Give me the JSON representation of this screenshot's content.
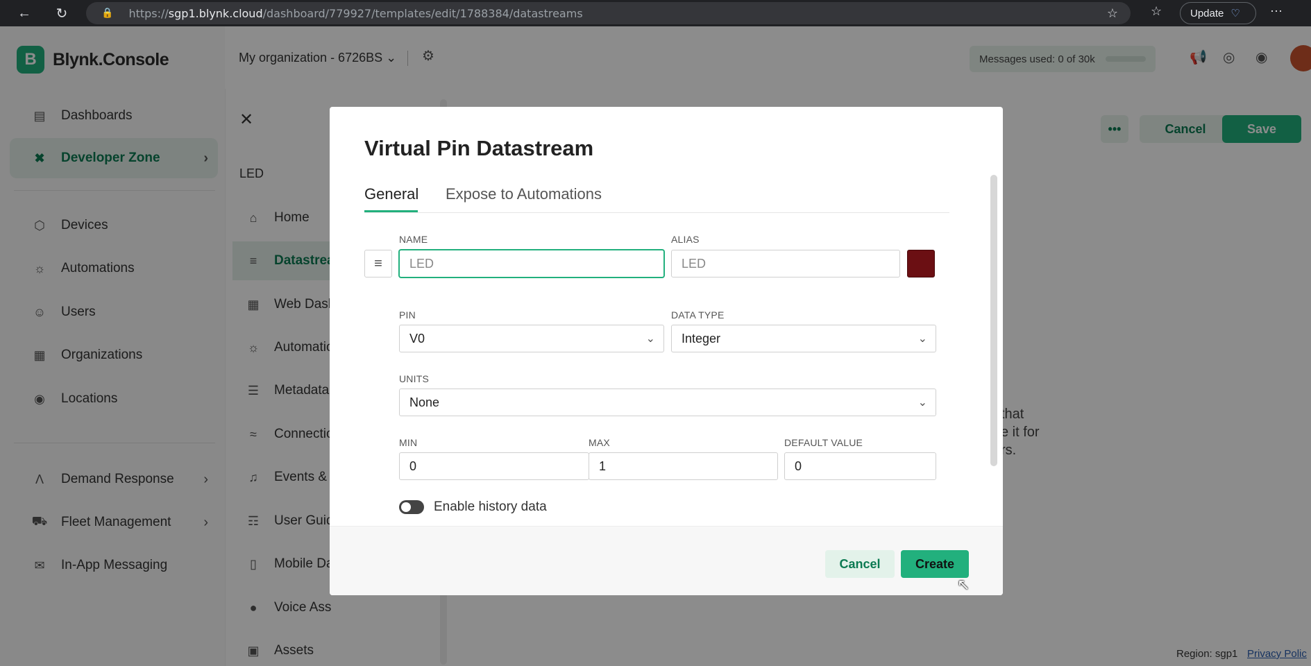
{
  "browser": {
    "url_prefix": "https://",
    "url_host": "sgp1.blynk.cloud",
    "url_path": "/dashboard/779927/templates/edit/1788384/datastreams",
    "update_label": "Update"
  },
  "app": {
    "logo_letter": "B",
    "logo_text": "Blynk.Console",
    "org_name": "My organization - 6726BS",
    "messages_used": "Messages used: 0 of 30k",
    "sidebar": [
      {
        "label": "Dashboards",
        "icon": "chart-icon"
      },
      {
        "label": "Developer Zone",
        "icon": "tools-icon",
        "active": true,
        "chevron": true
      },
      {
        "label": "Devices",
        "icon": "cube-icon"
      },
      {
        "label": "Automations",
        "icon": "sun-icon"
      },
      {
        "label": "Users",
        "icon": "users-icon"
      },
      {
        "label": "Organizations",
        "icon": "building-icon"
      },
      {
        "label": "Locations",
        "icon": "pin-icon"
      },
      {
        "label": "Demand Response",
        "icon": "response-icon",
        "chevron": true
      },
      {
        "label": "Fleet Management",
        "icon": "truck-icon",
        "chevron": true
      },
      {
        "label": "In-App Messaging",
        "icon": "message-icon"
      }
    ],
    "panel": {
      "title": "LED",
      "items": [
        {
          "label": "Home",
          "icon": "home-icon"
        },
        {
          "label": "Datastrea",
          "icon": "datastream-icon",
          "active": true
        },
        {
          "label": "Web Dash",
          "icon": "grid-icon"
        },
        {
          "label": "Automatio",
          "icon": "sun-icon"
        },
        {
          "label": "Metadata",
          "icon": "list-icon"
        },
        {
          "label": "Connectio",
          "icon": "wifi-icon"
        },
        {
          "label": "Events & N",
          "icon": "bell-icon"
        },
        {
          "label": "User Guid",
          "icon": "book-icon"
        },
        {
          "label": "Mobile Da",
          "icon": "mobile-icon"
        },
        {
          "label": "Voice Ass",
          "icon": "mic-icon"
        },
        {
          "label": "Assets",
          "icon": "image-icon"
        }
      ]
    },
    "main": {
      "more_label": "•••",
      "cancel_label": "Cancel",
      "save_label": "Save",
      "text_lines": [
        "that",
        "e it for",
        "rs."
      ]
    },
    "footer": {
      "region": "Region: sgp1",
      "privacy": "Privacy Polic"
    }
  },
  "modal": {
    "title": "Virtual Pin Datastream",
    "tabs": [
      "General",
      "Expose to Automations"
    ],
    "name": {
      "label": "NAME",
      "value": "LED"
    },
    "alias": {
      "label": "ALIAS",
      "value": "LED"
    },
    "color": "#6b0f13",
    "pin": {
      "label": "PIN",
      "value": "V0"
    },
    "data_type": {
      "label": "DATA TYPE",
      "value": "Integer"
    },
    "units": {
      "label": "UNITS",
      "value": "None"
    },
    "min": {
      "label": "MIN",
      "value": "0"
    },
    "max": {
      "label": "MAX",
      "value": "1"
    },
    "default_value": {
      "label": "DEFAULT VALUE",
      "value": "0"
    },
    "history_toggle": {
      "label": "Enable history data",
      "enabled": false
    },
    "cancel_label": "Cancel",
    "create_label": "Create"
  }
}
